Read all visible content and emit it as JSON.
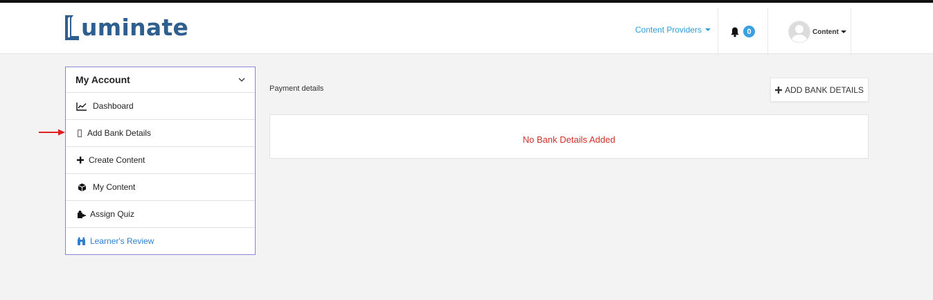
{
  "header": {
    "logo_text": "uminate",
    "logo_aria": "Luminate",
    "nav_providers": "Content Providers",
    "notifications_count": "0",
    "user_label": "Content"
  },
  "sidebar": {
    "title": "My Account",
    "items": [
      {
        "label": "Dashboard",
        "icon": "line-chart-icon"
      },
      {
        "label": "Add Bank Details",
        "icon": "missing-glyph-icon"
      },
      {
        "label": "Create Content",
        "icon": "plus-icon"
      },
      {
        "label": "My Content",
        "icon": "cube-icon"
      },
      {
        "label": "Assign Quiz",
        "icon": "puzzle-icon"
      },
      {
        "label": "Learner's Review",
        "icon": "binoculars-icon"
      }
    ]
  },
  "main": {
    "section_label": "Payment details",
    "add_button_label": "ADD BANK DETAILS",
    "empty_message": "No Bank Details Added"
  },
  "colors": {
    "accent_blue": "#2e9fd9",
    "badge_blue": "#3aa0e3",
    "logo_blue": "#2f5f8e",
    "sidebar_border": "#8a84d6",
    "error_red": "#d0302a",
    "annotation_arrow": "#e02020"
  }
}
